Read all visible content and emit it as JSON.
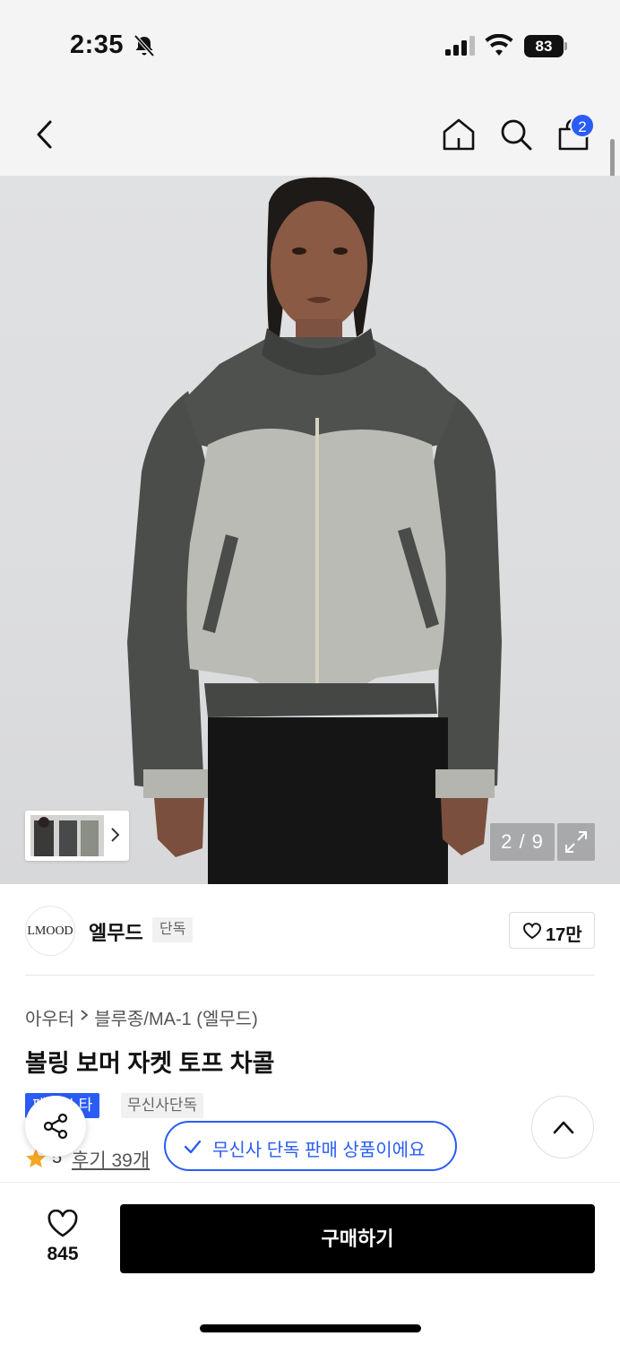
{
  "status_bar": {
    "time": "2:35",
    "battery": "83",
    "icons": [
      "bell-slash-icon",
      "signal-icon",
      "wifi-icon",
      "battery-icon"
    ]
  },
  "header": {
    "icons": [
      "back-icon",
      "home-icon",
      "search-icon",
      "cart-icon"
    ],
    "cart_count": "2"
  },
  "gallery": {
    "page_indicator": "2 / 9",
    "icons": [
      "chevron-right-icon",
      "expand-icon"
    ]
  },
  "brand": {
    "logo_text": "LMOOD",
    "name": "엘무드",
    "tag": "단독",
    "likes": "17만"
  },
  "product": {
    "breadcrumb": [
      "아우터",
      "블루종/MA-1 (엘무드)"
    ],
    "title": "볼링 보머 자켓 토프 차콜",
    "tags": [
      "페 베스타",
      "무신사단독"
    ],
    "rating": "5",
    "review_label": "후기 39개"
  },
  "toast": {
    "text": "무신사 단독 판매 상품이에요"
  },
  "bottom_bar": {
    "like_count": "845",
    "buy_label": "구매하기"
  },
  "colors": {
    "accent_blue": "#2a5cf6",
    "star": "#f5a623",
    "buy_button": "#000000"
  }
}
